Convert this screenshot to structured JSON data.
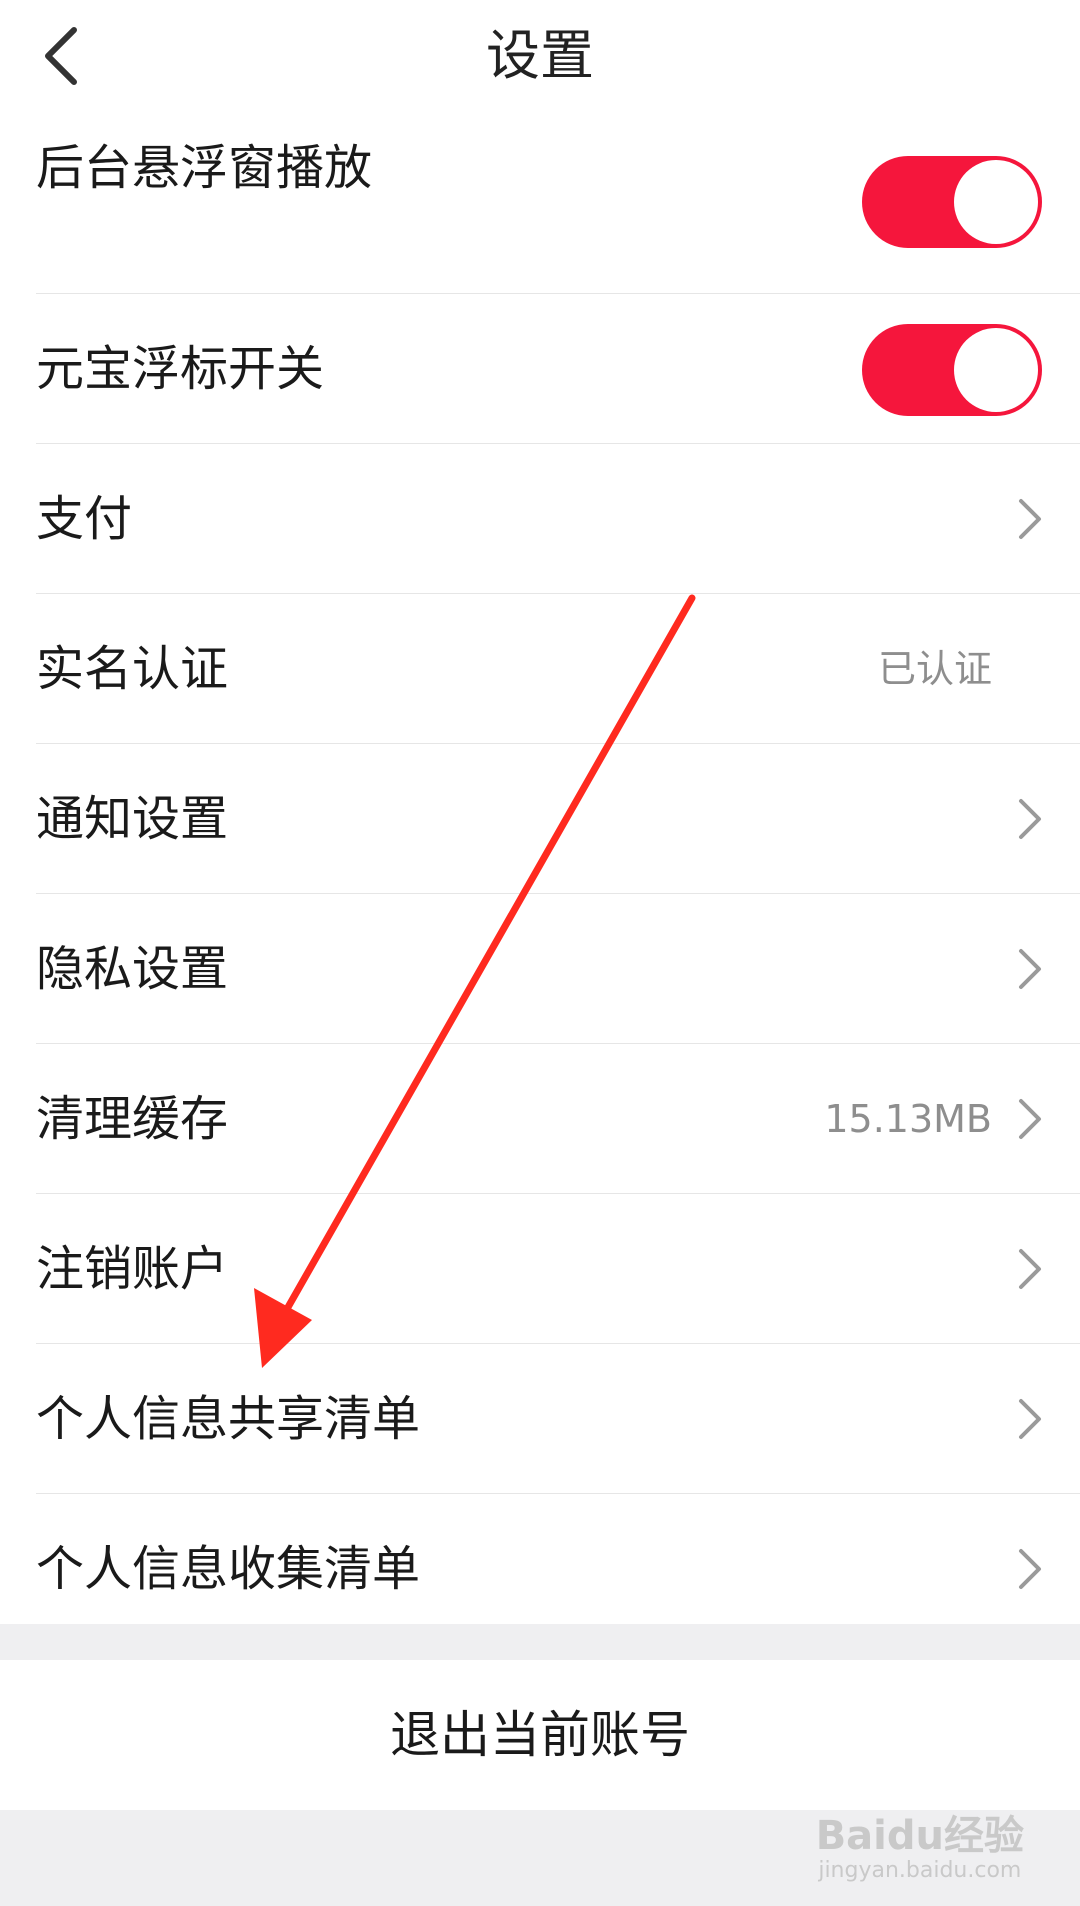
{
  "header": {
    "title": "设置",
    "back_icon": "chevron-left-icon"
  },
  "settings": {
    "items": [
      {
        "label": "后台悬浮窗播放",
        "control": "toggle",
        "on": true
      },
      {
        "label": "元宝浮标开关",
        "control": "toggle",
        "on": true
      },
      {
        "label": "支付",
        "control": "chevron"
      },
      {
        "label": "实名认证",
        "value": "已认证",
        "control": "none"
      },
      {
        "label": "通知设置",
        "control": "chevron"
      },
      {
        "label": "隐私设置",
        "control": "chevron"
      },
      {
        "label": "清理缓存",
        "value": "15.13MB",
        "control": "chevron"
      },
      {
        "label": "注销账户",
        "control": "chevron"
      },
      {
        "label": "个人信息共享清单",
        "control": "chevron"
      },
      {
        "label": "个人信息收集清单",
        "control": "chevron"
      }
    ]
  },
  "logout": {
    "label": "退出当前账号"
  },
  "colors": {
    "accent": "#f5163c",
    "annotation_arrow": "#ff2a1f"
  },
  "watermark": {
    "logo": "Baidu经验",
    "url": "jingyan.baidu.com"
  }
}
